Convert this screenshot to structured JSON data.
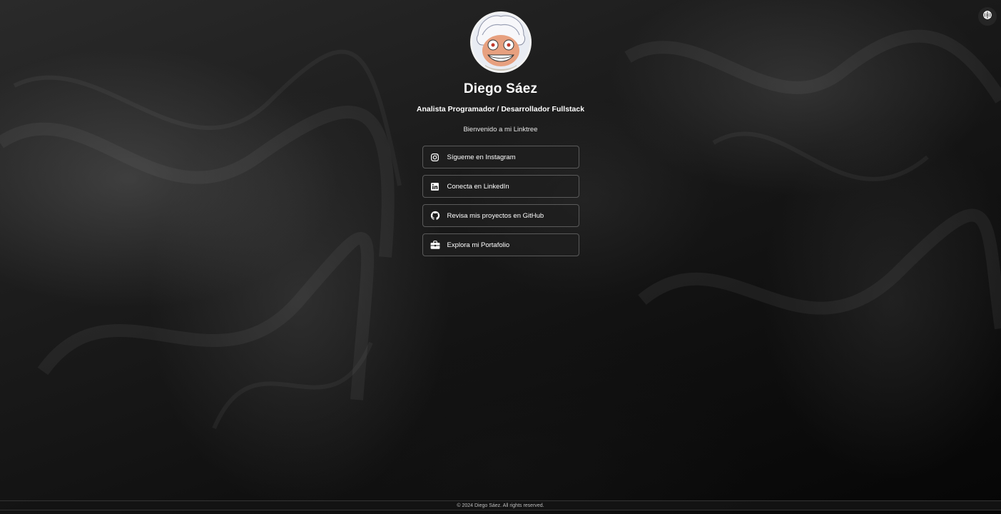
{
  "profile": {
    "name": "Diego Sáez",
    "role": "Analista Programador / Desarrollador Fullstack",
    "welcome": "Bienvenido a mi Linktree",
    "avatar_icon": "avatar-illustration"
  },
  "links": [
    {
      "label": "Sígueme en Instagram",
      "icon": "instagram-icon"
    },
    {
      "label": "Conecta en LinkedIn",
      "icon": "linkedin-icon"
    },
    {
      "label": "Revisa mis proyectos en GitHub",
      "icon": "github-icon"
    },
    {
      "label": "Explora mi Portafolio",
      "icon": "briefcase-icon"
    }
  ],
  "top_right": {
    "icon": "globe-icon"
  },
  "footer": {
    "text": "© 2024 Diego Sáez. All rights reserved."
  }
}
